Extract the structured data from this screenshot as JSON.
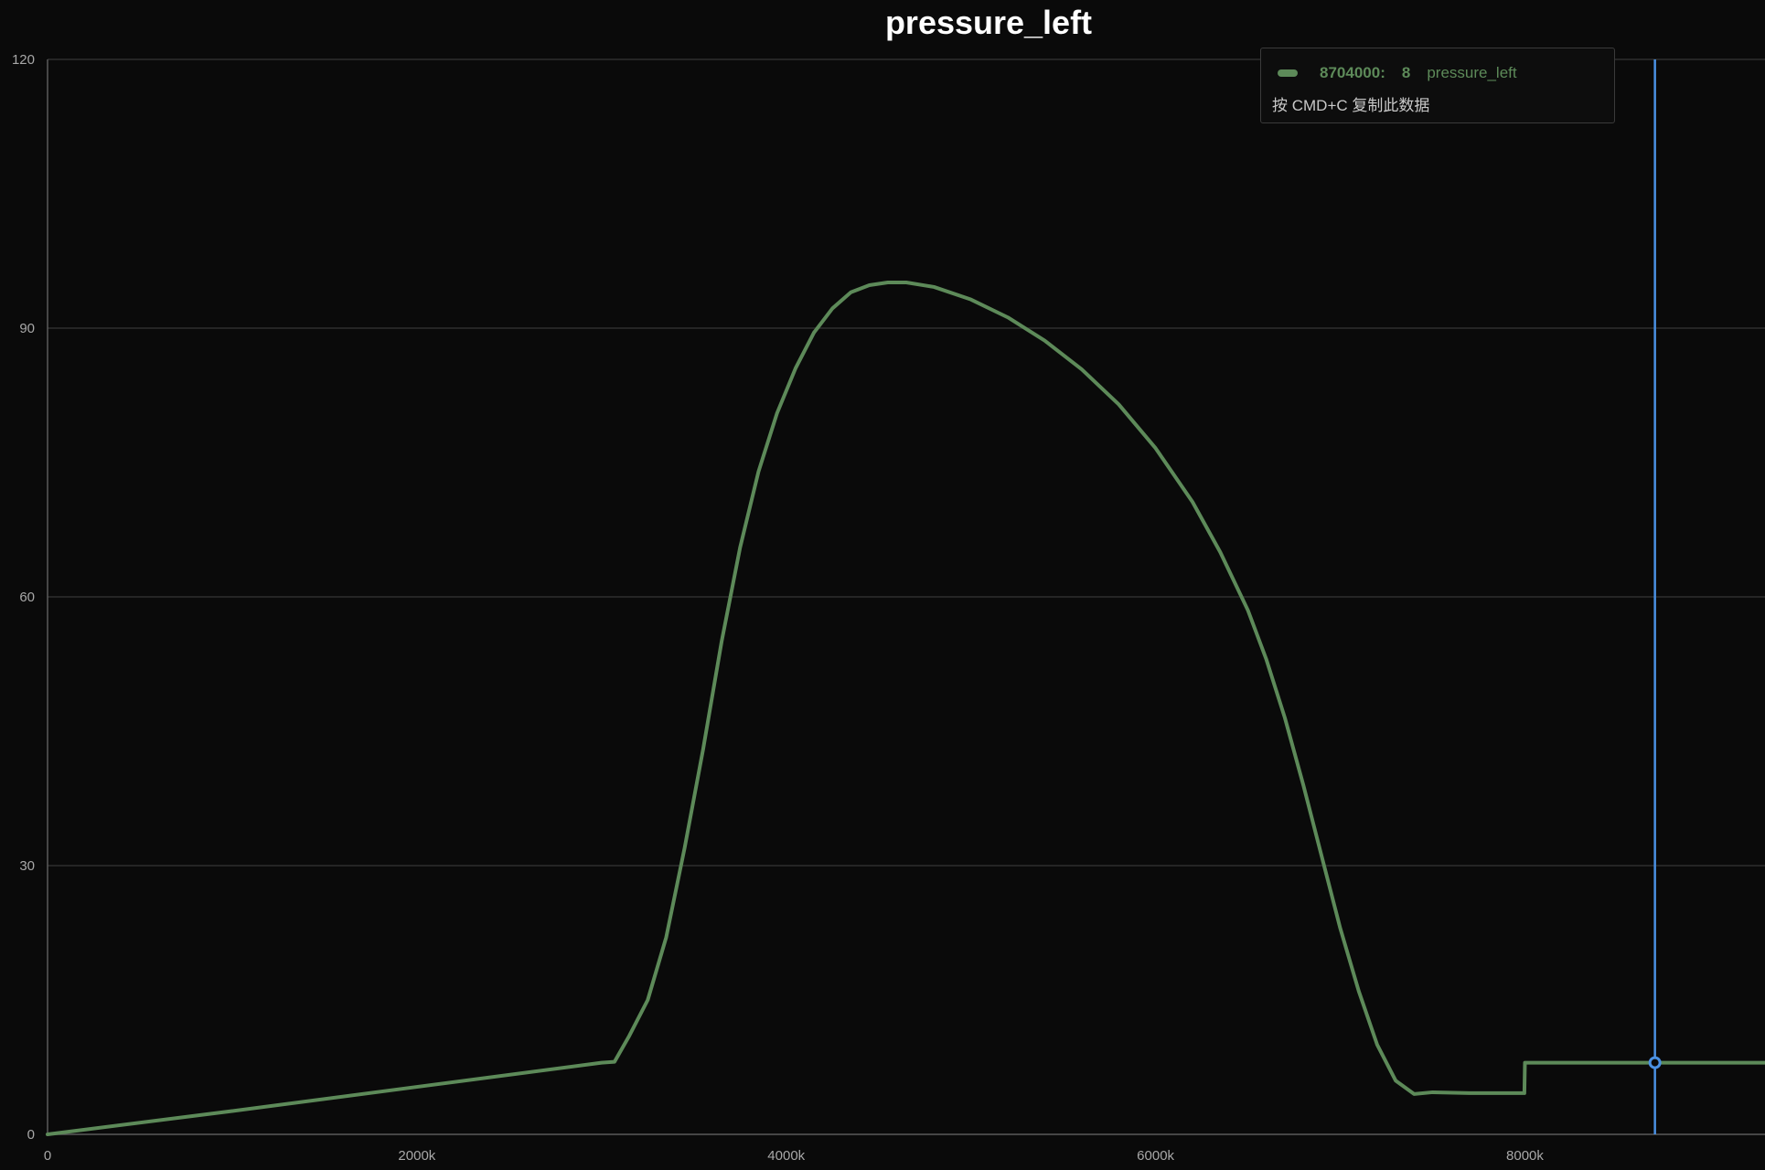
{
  "colors": {
    "background": "#0a0a0a",
    "grid": "#2e2e2e",
    "axis": "#5a5a5a",
    "series": "#5d8a59",
    "cursor": "#4a90e2"
  },
  "chart_data": {
    "type": "line",
    "title": "pressure_left",
    "xlabel": "",
    "ylabel": "",
    "xlim": [
      0,
      9300000
    ],
    "ylim": [
      0,
      120
    ],
    "x_ticks": [
      0,
      2000000,
      4000000,
      6000000,
      8000000
    ],
    "x_tick_labels": [
      "0",
      "2000k",
      "4000k",
      "6000k",
      "8000k"
    ],
    "y_ticks": [
      0,
      30,
      60,
      90,
      120
    ],
    "y_tick_labels": [
      "0",
      "30",
      "60",
      "90",
      "120"
    ],
    "grid": true,
    "series": [
      {
        "name": "pressure_left",
        "color": "#5d8a59",
        "points": [
          [
            0,
            0
          ],
          [
            1000000,
            2.6
          ],
          [
            2000000,
            5.3
          ],
          [
            3000000,
            8.0
          ],
          [
            3070000,
            8.1
          ],
          [
            3150000,
            11.0
          ],
          [
            3250000,
            15.0
          ],
          [
            3350000,
            22.0
          ],
          [
            3450000,
            32.0
          ],
          [
            3550000,
            43.0
          ],
          [
            3650000,
            55.0
          ],
          [
            3750000,
            65.5
          ],
          [
            3850000,
            74.0
          ],
          [
            3950000,
            80.5
          ],
          [
            4050000,
            85.5
          ],
          [
            4150000,
            89.5
          ],
          [
            4250000,
            92.2
          ],
          [
            4350000,
            94.0
          ],
          [
            4450000,
            94.8
          ],
          [
            4550000,
            95.1
          ],
          [
            4650000,
            95.1
          ],
          [
            4800000,
            94.6
          ],
          [
            5000000,
            93.2
          ],
          [
            5200000,
            91.2
          ],
          [
            5400000,
            88.6
          ],
          [
            5600000,
            85.4
          ],
          [
            5800000,
            81.5
          ],
          [
            6000000,
            76.6
          ],
          [
            6200000,
            70.6
          ],
          [
            6350000,
            65.0
          ],
          [
            6500000,
            58.5
          ],
          [
            6600000,
            53.0
          ],
          [
            6700000,
            46.5
          ],
          [
            6800000,
            39.0
          ],
          [
            6900000,
            31.0
          ],
          [
            7000000,
            23.0
          ],
          [
            7100000,
            16.0
          ],
          [
            7200000,
            10.0
          ],
          [
            7300000,
            6.0
          ],
          [
            7400000,
            4.5
          ],
          [
            7500000,
            4.7
          ],
          [
            7700000,
            4.6
          ],
          [
            7997000,
            4.6
          ],
          [
            8000000,
            8.0
          ],
          [
            9300000,
            8.0
          ]
        ]
      }
    ],
    "cursor": {
      "x": 8704000,
      "y": 8
    }
  },
  "tooltip": {
    "x_value": "8704000",
    "y_value": "8",
    "series_name": "pressure_left",
    "hint": "按 CMD+C 复制此数据"
  }
}
